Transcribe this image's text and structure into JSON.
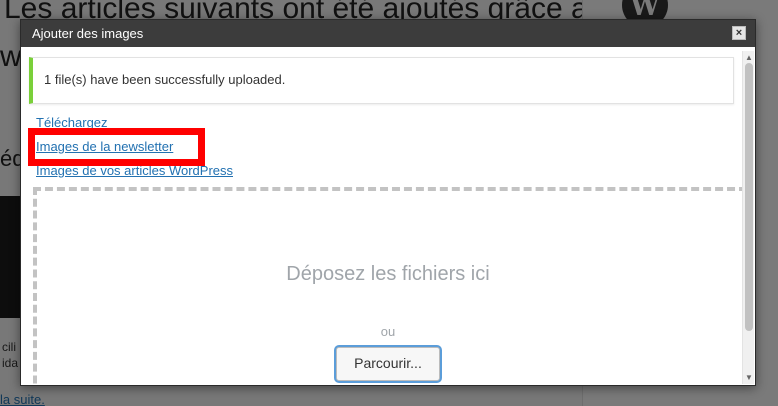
{
  "background": {
    "heading_line1": "Les articles suivants ont été ajoutés grâce au",
    "heading_line2": "wi",
    "left_fragment": "éd",
    "small_text_1": "cili",
    "small_text_2": "ida",
    "read_more_link": "la suite."
  },
  "modal": {
    "title": "Ajouter des images",
    "close_label": "×",
    "notice": "1 file(s) have been successfully uploaded.",
    "notice_border_color": "#7ad03a",
    "tabs": [
      {
        "label": "Téléchargez"
      },
      {
        "label": "Images de la newsletter"
      },
      {
        "label": "Images de vos articles WordPress"
      }
    ],
    "dropzone": {
      "title": "Déposez les fichiers ici",
      "or_text": "ou",
      "browse_button": "Parcourir..."
    },
    "highlight_color": "#ff0000",
    "link_color": "#2271b1"
  }
}
